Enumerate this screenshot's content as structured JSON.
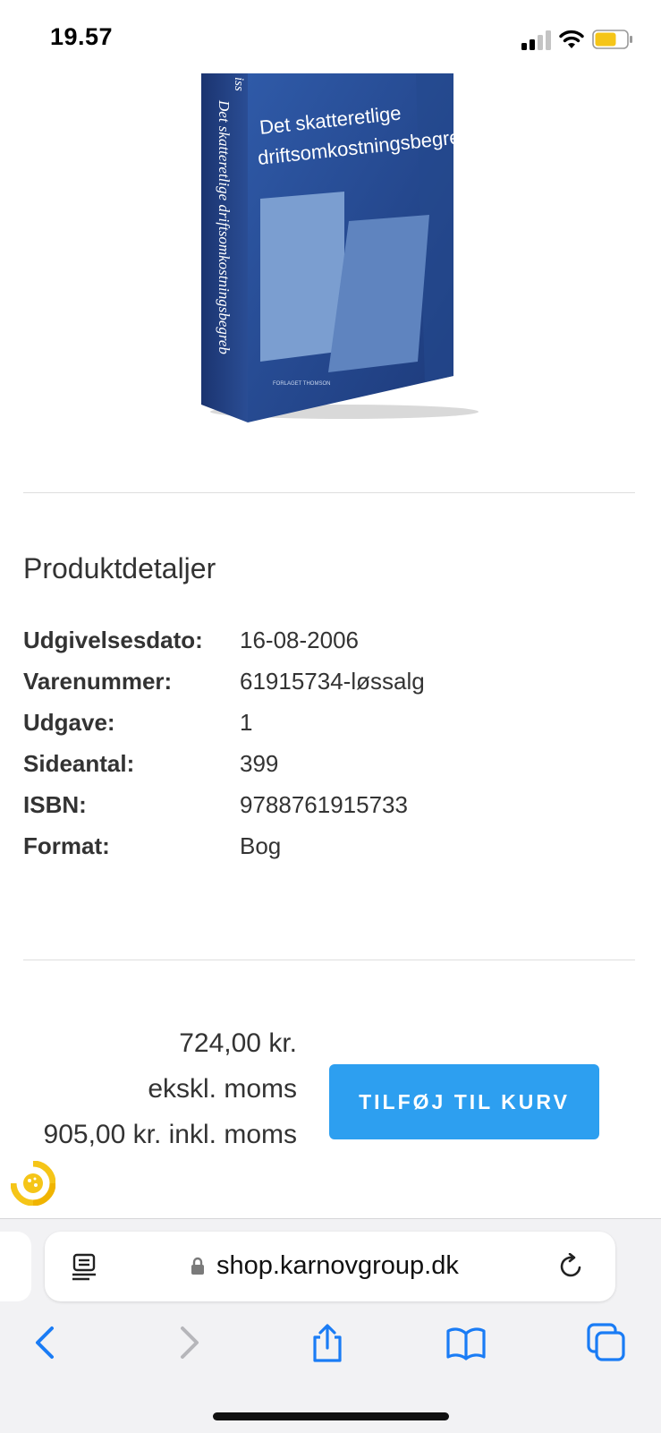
{
  "status_bar": {
    "time": "19.57",
    "battery_color": "#f5c518"
  },
  "book": {
    "title_line1": "Det skatteretlige",
    "title_line2": "driftsomkostningsbegreb",
    "spine_text": "Det skatteretlige driftsomkostningsbegreb",
    "spine_author_fragment": "iss",
    "publisher": "FORLAGET THOMSON",
    "cover_color": "#2b4f96"
  },
  "details": {
    "title": "Produktdetaljer",
    "rows": [
      {
        "label": "Udgivelsesdato:",
        "value": "16-08-2006"
      },
      {
        "label": "Varenummer:",
        "value": "61915734-løssalg"
      },
      {
        "label": "Udgave:",
        "value": "1"
      },
      {
        "label": "Sideantal:",
        "value": "399"
      },
      {
        "label": "ISBN:",
        "value": "9788761915733"
      },
      {
        "label": "Format:",
        "value": "Bog"
      }
    ]
  },
  "price": {
    "excl_amount": "724,00 kr.",
    "excl_label": "ekskl. moms",
    "incl": "905,00 kr. inkl. moms"
  },
  "cart_button": {
    "label": "TILFØJ TIL KURV",
    "color": "#2d9ff0"
  },
  "browser": {
    "url": "shop.karnovgroup.dk",
    "icons": [
      "reader-icon",
      "lock-icon",
      "reload-icon",
      "back-icon",
      "forward-icon",
      "share-icon",
      "bookmarks-icon",
      "tabs-icon"
    ],
    "accent": "#1a7cf5"
  }
}
